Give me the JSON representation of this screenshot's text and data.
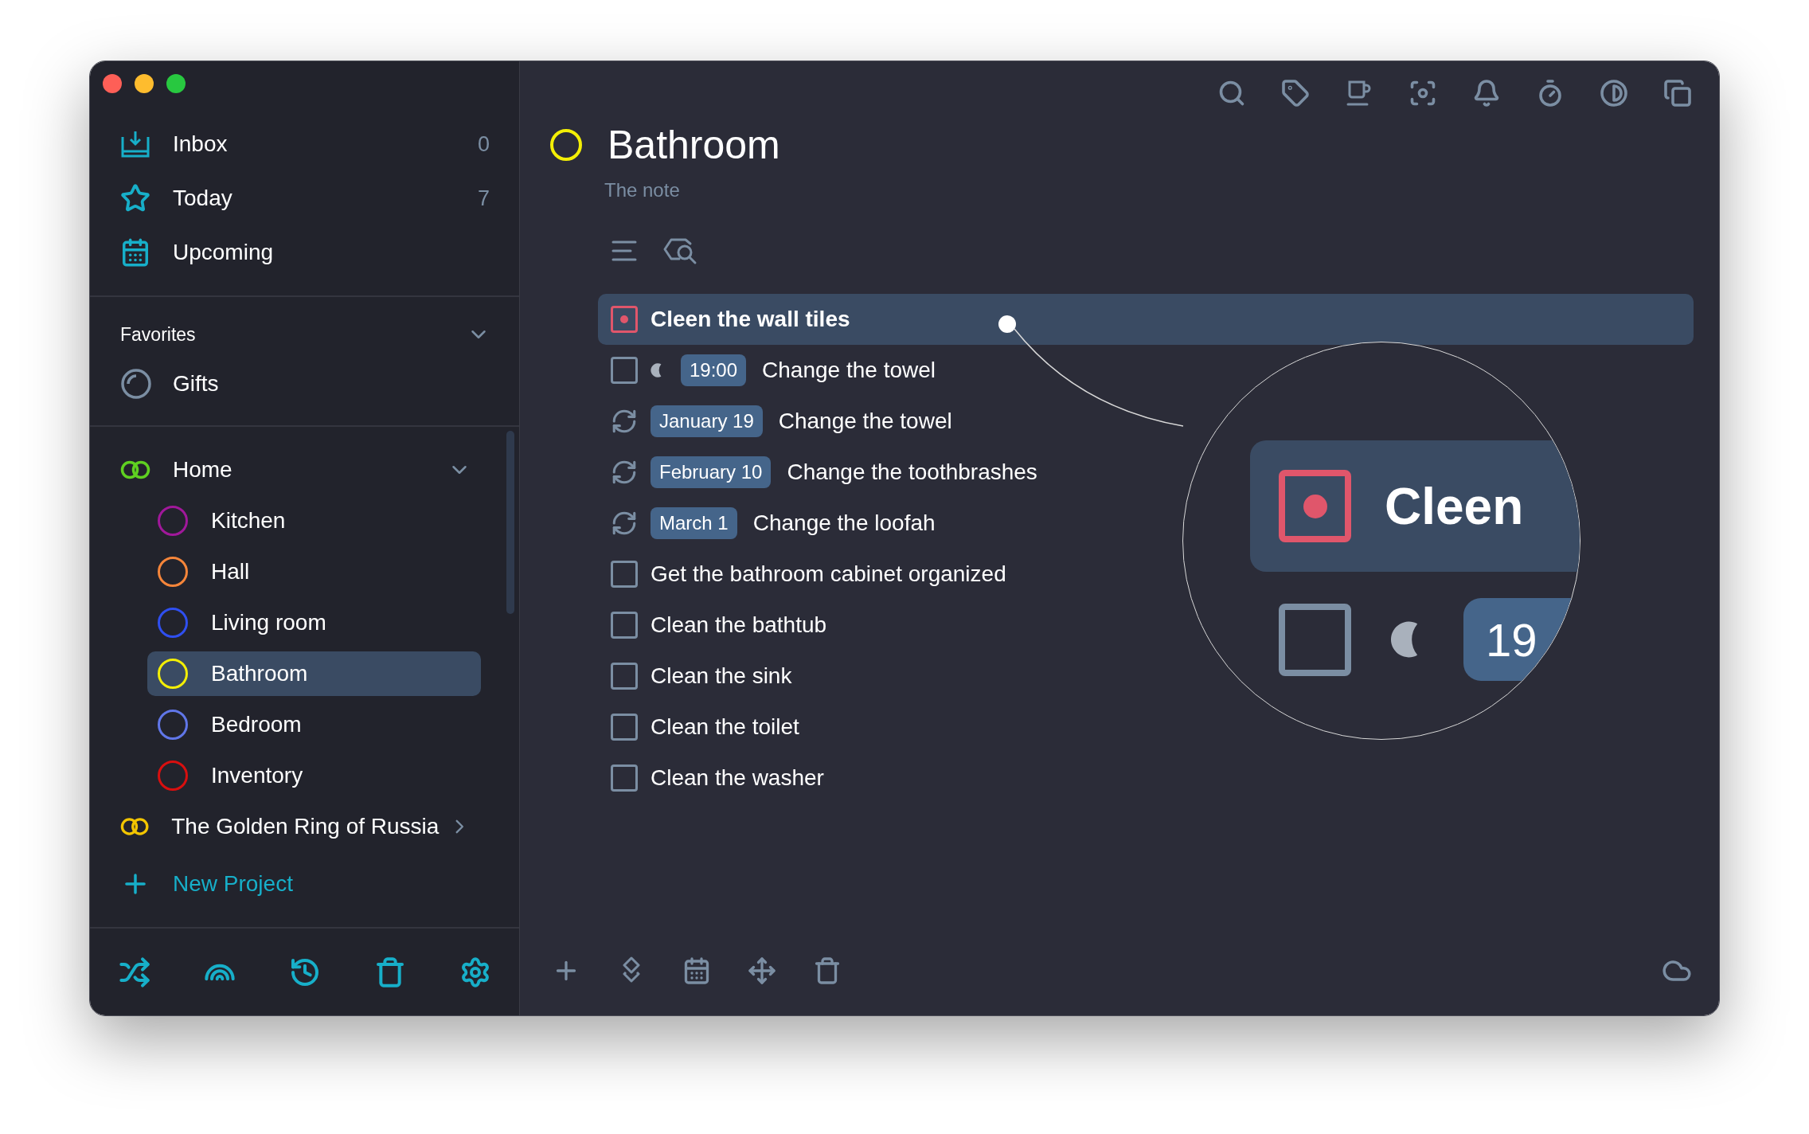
{
  "sidebar": {
    "nav": [
      {
        "kind": "inbox",
        "label": "Inbox",
        "count": "0"
      },
      {
        "kind": "today",
        "label": "Today",
        "count": "7"
      },
      {
        "kind": "upcoming",
        "label": "Upcoming"
      }
    ],
    "favorites": {
      "title": "Favorites",
      "expanded": true,
      "items": [
        {
          "label": "Gifts",
          "selected": false
        }
      ]
    },
    "projects": [
      {
        "label": "Home",
        "color": "#5fd021",
        "expanded": true,
        "selected": false,
        "children": [
          {
            "label": "Kitchen",
            "color": "#a0189a",
            "selected": false
          },
          {
            "label": "Hall",
            "color": "#f5853a",
            "selected": false
          },
          {
            "label": "Living room",
            "color": "#2f4ff0",
            "selected": false
          },
          {
            "label": "Bathroom",
            "color": "#f3ee06",
            "selected": true
          },
          {
            "label": "Bedroom",
            "color": "#6076e8",
            "selected": false
          },
          {
            "label": "Inventory",
            "color": "#d80f0f",
            "selected": false
          }
        ]
      },
      {
        "label": "The Golden Ring of Russia",
        "color": "#f2c500",
        "expanded": false,
        "selected": false
      }
    ],
    "new_project": "New Project"
  },
  "project": {
    "title": "Bathroom",
    "color": "#f3ee06",
    "note": "The note"
  },
  "tasks": [
    {
      "kind": "checkbox",
      "text": "Cleen the wall tiles",
      "priority": true,
      "selected": true
    },
    {
      "kind": "checkbox",
      "text": "Change the towel",
      "evening": true,
      "tag": "19:00",
      "priority": false,
      "selected": false
    },
    {
      "kind": "repeat",
      "tag": "January 19",
      "text": "Change the towel",
      "selected": false
    },
    {
      "kind": "repeat",
      "tag": "February 10",
      "text": "Change the toothbrashes",
      "selected": false
    },
    {
      "kind": "repeat",
      "tag": "March 1",
      "text": "Change the loofah",
      "selected": false
    },
    {
      "kind": "checkbox",
      "text": "Get the bathroom cabinet organized",
      "priority": false,
      "selected": false
    },
    {
      "kind": "checkbox",
      "text": "Clean the bathtub",
      "priority": false,
      "selected": false
    },
    {
      "kind": "checkbox",
      "text": "Clean the sink",
      "priority": false,
      "selected": false
    },
    {
      "kind": "checkbox",
      "text": "Clean the toilet",
      "priority": false,
      "selected": false
    },
    {
      "kind": "checkbox",
      "text": "Clean the washer",
      "priority": false,
      "selected": false
    }
  ],
  "magnifier": {
    "rows": [
      {
        "text": "Cleen",
        "priority": true,
        "selected": true
      },
      {
        "tag": "19",
        "priority": false,
        "evening": true,
        "selected": false
      }
    ]
  }
}
